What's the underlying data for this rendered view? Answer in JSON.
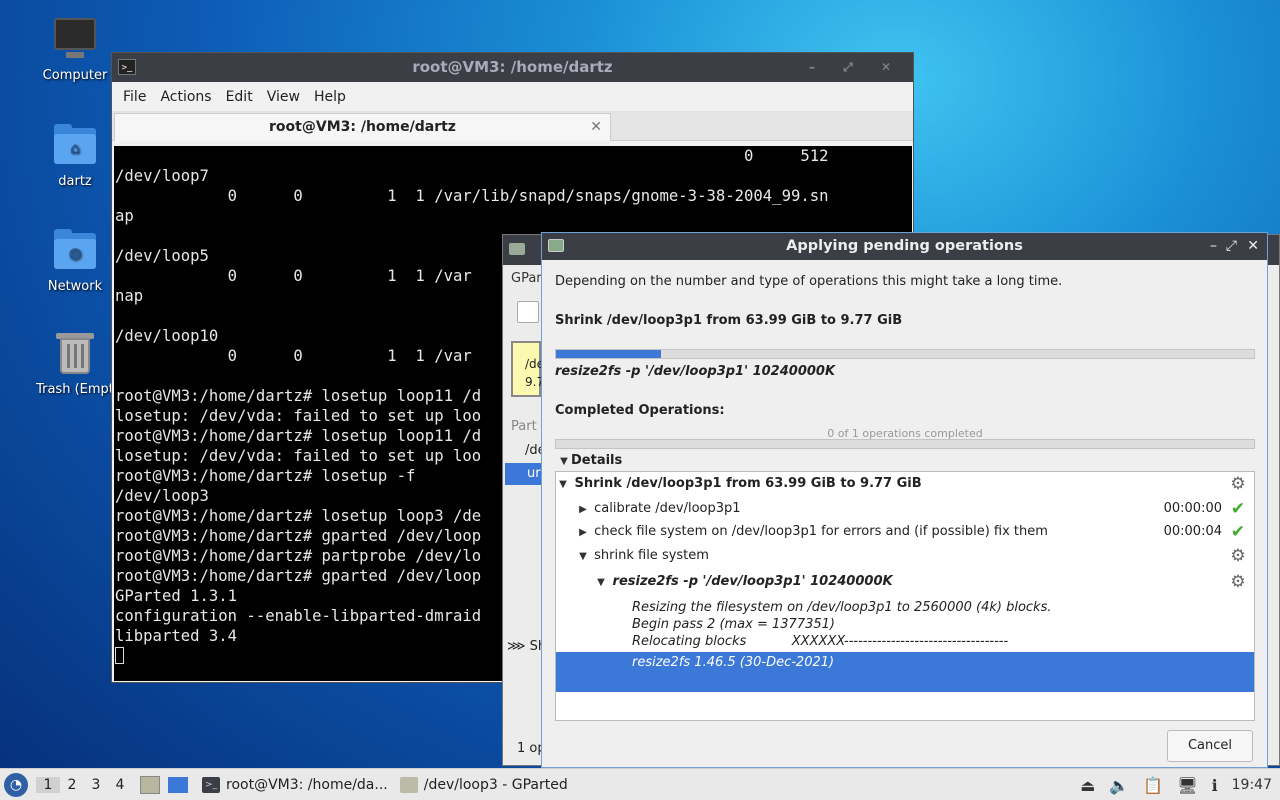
{
  "desktop": {
    "icons": [
      {
        "label": "Computer"
      },
      {
        "label": "dartz"
      },
      {
        "label": "Network"
      },
      {
        "label": "Trash (Empt"
      }
    ]
  },
  "terminal": {
    "title": "root@VM3: /home/dartz",
    "menu": [
      "File",
      "Actions",
      "Edit",
      "View",
      "Help"
    ],
    "tab_title": "root@VM3: /home/dartz",
    "lines": [
      "                                                                   0     512",
      "/dev/loop7",
      "            0      0         1  1 /var/lib/snapd/snaps/gnome-3-38-2004_99.sn",
      "ap",
      "",
      "/dev/loop5",
      "            0      0         1  1 /var",
      "nap",
      "",
      "/dev/loop10",
      "            0      0         1  1 /var",
      "",
      "root@VM3:/home/dartz# losetup loop11 /d",
      "losetup: /dev/vda: failed to set up loo",
      "root@VM3:/home/dartz# losetup loop11 /d",
      "losetup: /dev/vda: failed to set up loo",
      "root@VM3:/home/dartz# losetup -f",
      "/dev/loop3",
      "root@VM3:/home/dartz# losetup loop3 /de",
      "root@VM3:/home/dartz# gparted /dev/loop",
      "root@VM3:/home/dartz# partprobe /dev/lo",
      "root@VM3:/home/dartz# gparted /dev/loop",
      "GParted 1.3.1",
      "configuration --enable-libparted-dmraid",
      "libparted 3.4"
    ]
  },
  "gparted": {
    "menu_fragment": "GPart",
    "device_box": [
      "/de",
      "9.7"
    ],
    "partition_header": "Part",
    "row1": "/de",
    "row2": "ur",
    "sh": "Sh",
    "status": "1 op"
  },
  "dialog": {
    "title": "Applying pending operations",
    "intro": "Depending on the number and type of operations this might take a long time.",
    "current_op": "Shrink /dev/loop3p1 from 63.99 GiB to 9.77 GiB",
    "current_progress": 0.15,
    "current_cmd": "resize2fs -p '/dev/loop3p1' 10240000K",
    "completed_label": "Completed Operations:",
    "ops_progress_text": "0 of 1 operations completed",
    "ops_progress": 0,
    "details_label": "Details",
    "tree": {
      "root": "Shrink /dev/loop3p1 from 63.99 GiB to 9.77 GiB",
      "items": [
        {
          "label": "calibrate /dev/loop3p1",
          "time": "00:00:00",
          "status": "ok"
        },
        {
          "label": "check file system on /dev/loop3p1 for errors and (if possible) fix them",
          "time": "00:00:04",
          "status": "ok"
        },
        {
          "label": "shrink file system",
          "time": "",
          "status": "running"
        }
      ],
      "sub_cmd": "resize2fs -p '/dev/loop3p1' 10240000K",
      "messages": [
        "Resizing the filesystem on /dev/loop3p1 to 2560000 (4k) blocks.",
        "Begin pass 2 (max = 1377351)",
        "Relocating blocks           XXXXXX-----------------------------------"
      ],
      "selected_message": "resize2fs 1.46.5 (30-Dec-2021)"
    },
    "cancel_label": "Cancel"
  },
  "taskbar": {
    "workspaces": [
      "1",
      "2",
      "3",
      "4"
    ],
    "tasks": [
      {
        "label": "root@VM3: /home/da..."
      },
      {
        "label": "/dev/loop3 - GParted"
      }
    ],
    "clock": "19:47"
  }
}
